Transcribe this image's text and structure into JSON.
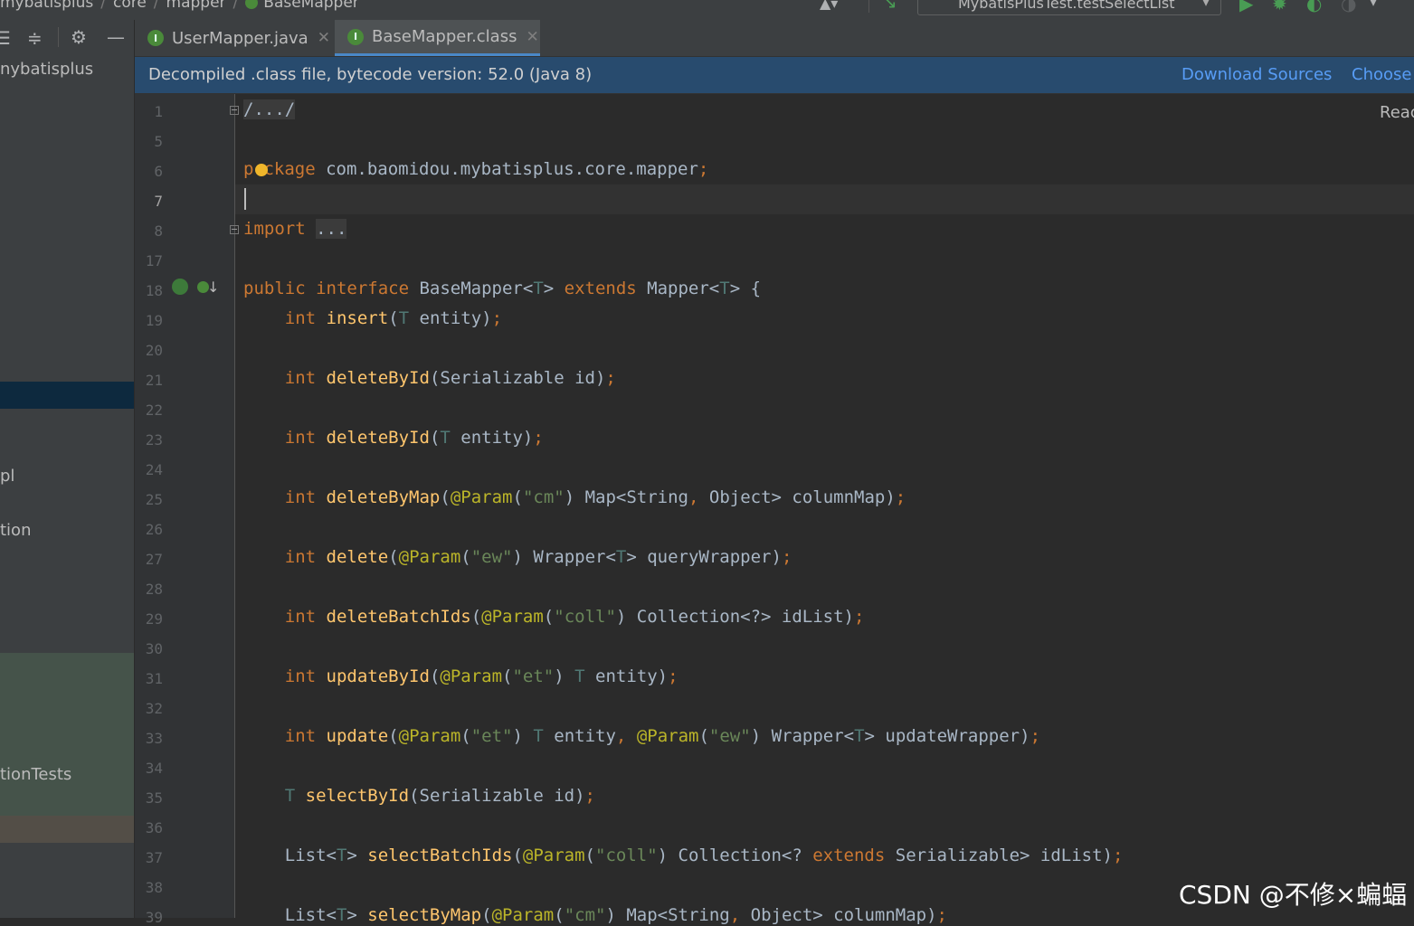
{
  "breadcrumbs": [
    "mybatisplus",
    "core",
    "mapper",
    "BaseMapper"
  ],
  "run_config": "MybatisPlusTest.testSelectList",
  "left_panel": {
    "toolbar_icons": [
      "expand-all-icon",
      "collapse-all-icon",
      "gear-icon",
      "minimize-icon"
    ],
    "items": [
      "nybatisplus",
      "pl",
      "tion",
      "tionTests"
    ]
  },
  "tabs": [
    {
      "label": "UserMapper.java",
      "icon": "I",
      "active": false
    },
    {
      "label": "BaseMapper.class",
      "icon": "I",
      "active": true
    }
  ],
  "banner": {
    "message": "Decompiled .class file, bytecode version: 52.0 (Java 8)",
    "download_sources": "Download Sources",
    "choose_sources": "Choose"
  },
  "reader_mode": "Reac",
  "line_numbers": [
    "1",
    "5",
    "6",
    "7",
    "8",
    "17",
    "18",
    "19",
    "20",
    "21",
    "22",
    "23",
    "24",
    "25",
    "26",
    "27",
    "28",
    "29",
    "30",
    "31",
    "32",
    "33",
    "34",
    "35",
    "36",
    "37",
    "38",
    "39"
  ],
  "code": {
    "l1": "/.../",
    "l6_a": "p",
    "l6_b": "ckage",
    "l6_c": " com.baomidou.mybatisplus.core.mapper",
    "l8_a": "import",
    "l8_b": "...",
    "l18_a": "public interface ",
    "l18_b": "BaseMapper<",
    "l18_c": "T",
    "l18_d": "> ",
    "l18_e": "extends ",
    "l18_f": "Mapper<",
    "l18_g": "T",
    "l18_h": "> {",
    "insert": "insert",
    "deleteById": "deleteById",
    "deleteByMap": "deleteByMap",
    "delete": "delete",
    "deleteBatchIds": "deleteBatchIds",
    "updateById": "updateById",
    "update": "update",
    "selectById": "selectById",
    "selectBatchIds": "selectBatchIds",
    "selectByMap": "selectByMap",
    "str_cm": "\"cm\"",
    "str_ew": "\"ew\"",
    "str_coll": "\"coll\"",
    "str_et": "\"et\"",
    "ann_param": "@Param"
  },
  "watermark": "CSDN @不修×蝙蝠",
  "colors": {
    "editor_bg": "#2b2b2b",
    "keyword": "#cc7832",
    "function": "#ffc66d",
    "annotation": "#bbb529",
    "string": "#6a8759",
    "type_param": "#507874",
    "banner_bg": "#284b6e",
    "link": "#589df6"
  }
}
